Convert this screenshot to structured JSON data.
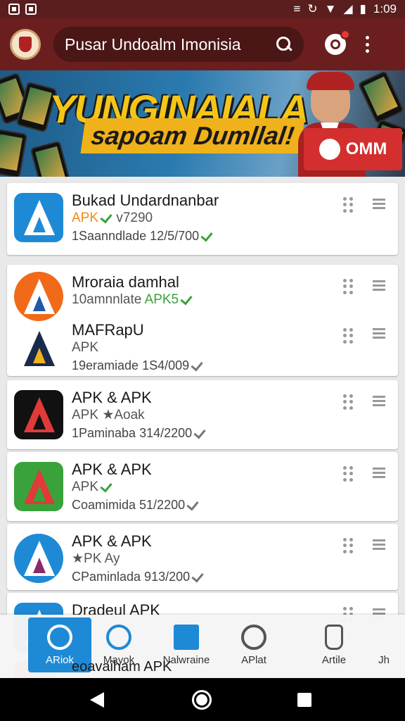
{
  "status_bar": {
    "time": "1:09"
  },
  "header": {
    "search_text": "Pusar Undoalm Imonisia"
  },
  "banner": {
    "title": "YUNGINAIALA",
    "subtitle": "sapoam Dumllal!",
    "button_label": "OMM"
  },
  "apps": [
    {
      "title": "Bukad Undardnanbar",
      "line2_prefix": "APK",
      "line2_rest": "v7290",
      "line3": "1Saanndlade 12/5/700"
    },
    {
      "title": "Mroraia damhal",
      "line2_prefix": "10amnnlate",
      "line2_rest": "APK5",
      "line3": ""
    },
    {
      "title": "MAFRapU",
      "line2_prefix": "APK",
      "line2_rest": "",
      "line3": "19eramiade 1S4/009"
    },
    {
      "title": "APK & APK",
      "line2_prefix": "APK",
      "line2_rest": "★Aoak",
      "line3": "1Paminaba 314/2200"
    },
    {
      "title": "APK & APK",
      "line2_prefix": "APK",
      "line2_rest": "",
      "line3": "Coamimida 51/2200"
    },
    {
      "title": "APK & APK",
      "line2_prefix": "★PK",
      "line2_rest": "Ay",
      "line3": "CPaminlada 913/200"
    },
    {
      "title": "Dradeul APK",
      "line2_prefix": "",
      "line2_rest": "",
      "line3": ""
    }
  ],
  "peek_text": "eoavaiham APK",
  "bottom_nav": [
    {
      "label": "ARiok"
    },
    {
      "label": "Mayok"
    },
    {
      "label": "Nalwraine"
    },
    {
      "label": "APlat"
    },
    {
      "label": "Artile"
    },
    {
      "label": "Jh"
    }
  ],
  "colors": {
    "app_bar": "#6b1e1e",
    "accent_blue": "#1e8ad6",
    "apk_orange": "#f08a1a",
    "verified_green": "#3aa23a"
  }
}
